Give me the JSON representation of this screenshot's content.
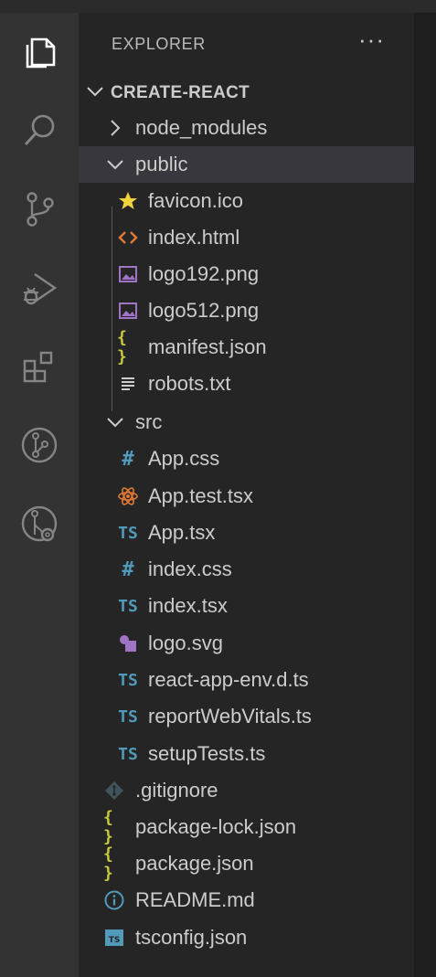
{
  "explorer": {
    "title": "EXPLORER",
    "more_icon": "ellipsis-icon",
    "more_label": "···"
  },
  "activity_bar": [
    {
      "name": "explorer-icon"
    },
    {
      "name": "search-icon"
    },
    {
      "name": "source-control-icon"
    },
    {
      "name": "run-debug-icon"
    },
    {
      "name": "extensions-icon"
    },
    {
      "name": "git-graph-icon"
    },
    {
      "name": "github-pull-requests-icon"
    }
  ],
  "tree": {
    "root": "CREATE-REACT",
    "node_modules": "node_modules",
    "public": {
      "label": "public",
      "files": [
        "favicon.ico",
        "index.html",
        "logo192.png",
        "logo512.png",
        "manifest.json",
        "robots.txt"
      ]
    },
    "src": {
      "label": "src",
      "files": [
        "App.css",
        "App.test.tsx",
        "App.tsx",
        "index.css",
        "index.tsx",
        "logo.svg",
        "react-app-env.d.ts",
        "reportWebVitals.ts",
        "setupTests.ts"
      ]
    },
    "root_files": [
      ".gitignore",
      "package-lock.json",
      "package.json",
      "README.md",
      "tsconfig.json"
    ]
  },
  "icon_glyphs": {
    "css": "#",
    "ts": "TS",
    "json": "{ }"
  },
  "colors": {
    "activity_bar": "#333333",
    "sidebar": "#252526",
    "selected_row": "#37373d",
    "ts_blue": "#519aba",
    "json_yellow": "#cbcb41",
    "html_orange": "#e37933",
    "image_purple": "#a074c4",
    "star_yellow": "#f1d33b"
  }
}
